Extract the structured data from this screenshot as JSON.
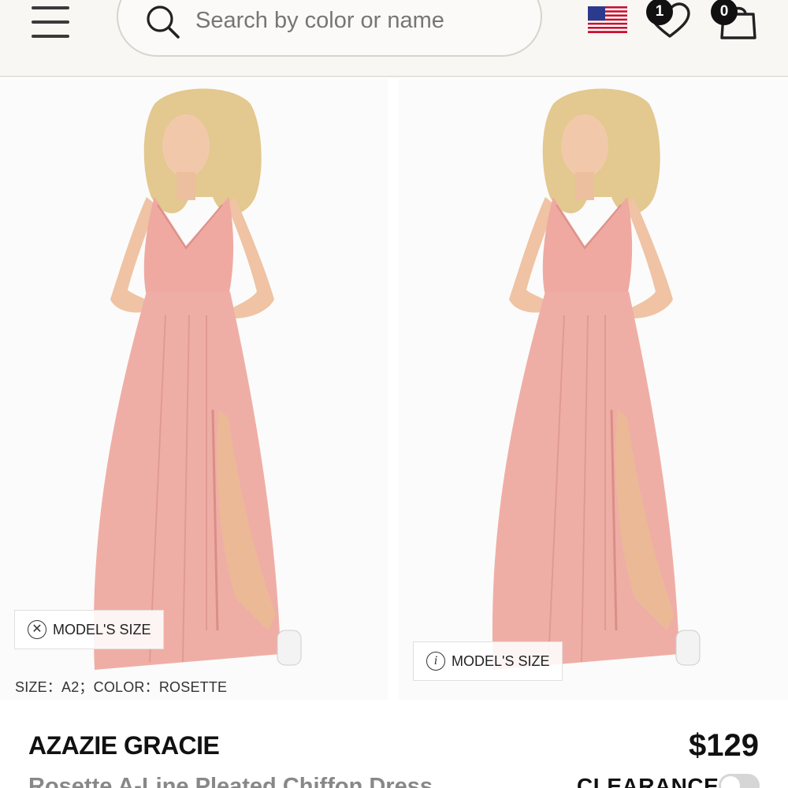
{
  "header": {
    "menu_icon": "hamburger-menu-icon",
    "search": {
      "placeholder": "Search by color or name",
      "value": "",
      "icon": "search-icon"
    },
    "flag_icon": "us-flag-icon",
    "wishlist": {
      "icon": "heart-icon",
      "count": "1"
    },
    "cart": {
      "icon": "shopping-bag-icon",
      "count": "0"
    }
  },
  "gallery": {
    "images": [
      {
        "model_size_label": "MODEL'S SIZE",
        "badge_icon": "close-icon"
      },
      {
        "model_size_label": "MODEL'S SIZE",
        "badge_icon": "info-icon"
      }
    ],
    "size_caption": "SIZE：A2；COLOR：ROSETTE"
  },
  "product": {
    "brand": "AZAZIE GRACIE",
    "price": "$129",
    "name": "Rosette A-Line Pleated Chiffon Dress",
    "clearance_label": "CLEARANCE"
  },
  "colors": {
    "dress": "#efaea5",
    "dress_shadow": "#d98e86",
    "skin": "#efc3a3",
    "hair": "#e3c88f",
    "header_bg": "#f8f7f4"
  }
}
